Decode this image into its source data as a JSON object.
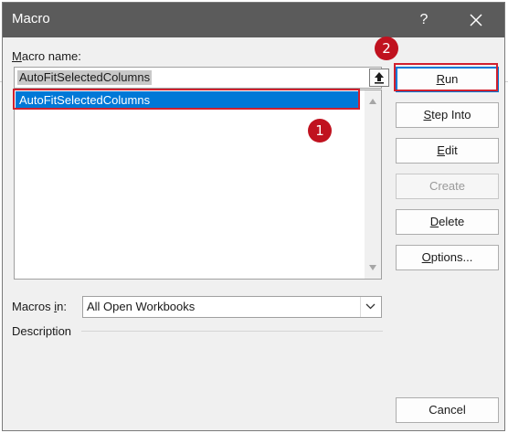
{
  "dialog": {
    "title": "Macro",
    "help_label": "?"
  },
  "macro_name": {
    "label_accel": "M",
    "label_rest": "acro name:",
    "value": "AutoFitSelectedColumns"
  },
  "macro_list": {
    "items": [
      "AutoFitSelectedColumns"
    ],
    "selected_index": 0
  },
  "buttons": {
    "run": {
      "accel": "R",
      "rest": "un"
    },
    "step_into": {
      "accel": "S",
      "rest": "tep Into"
    },
    "edit": {
      "accel": "E",
      "rest": "dit"
    },
    "create": "Create",
    "delete": {
      "accel": "D",
      "rest": "elete"
    },
    "options": {
      "accel": "O",
      "rest": "ptions..."
    },
    "cancel": "Cancel"
  },
  "macros_in": {
    "label_before": "Macros ",
    "label_accel": "i",
    "label_after": "n:",
    "value": "All Open Workbooks"
  },
  "description": {
    "label": "Description"
  },
  "annotations": {
    "step1": "1",
    "step2": "2",
    "color": "#c0121f"
  },
  "icons": {
    "close": "close-icon",
    "upload": "upload-arrow-icon",
    "scroll_up": "scroll-up-icon",
    "scroll_down": "scroll-down-icon",
    "dropdown": "chevron-down-icon"
  },
  "colors": {
    "titlebar": "#5b5b5b",
    "selection": "#0078d7",
    "dialog_bg": "#f0f0f0"
  }
}
